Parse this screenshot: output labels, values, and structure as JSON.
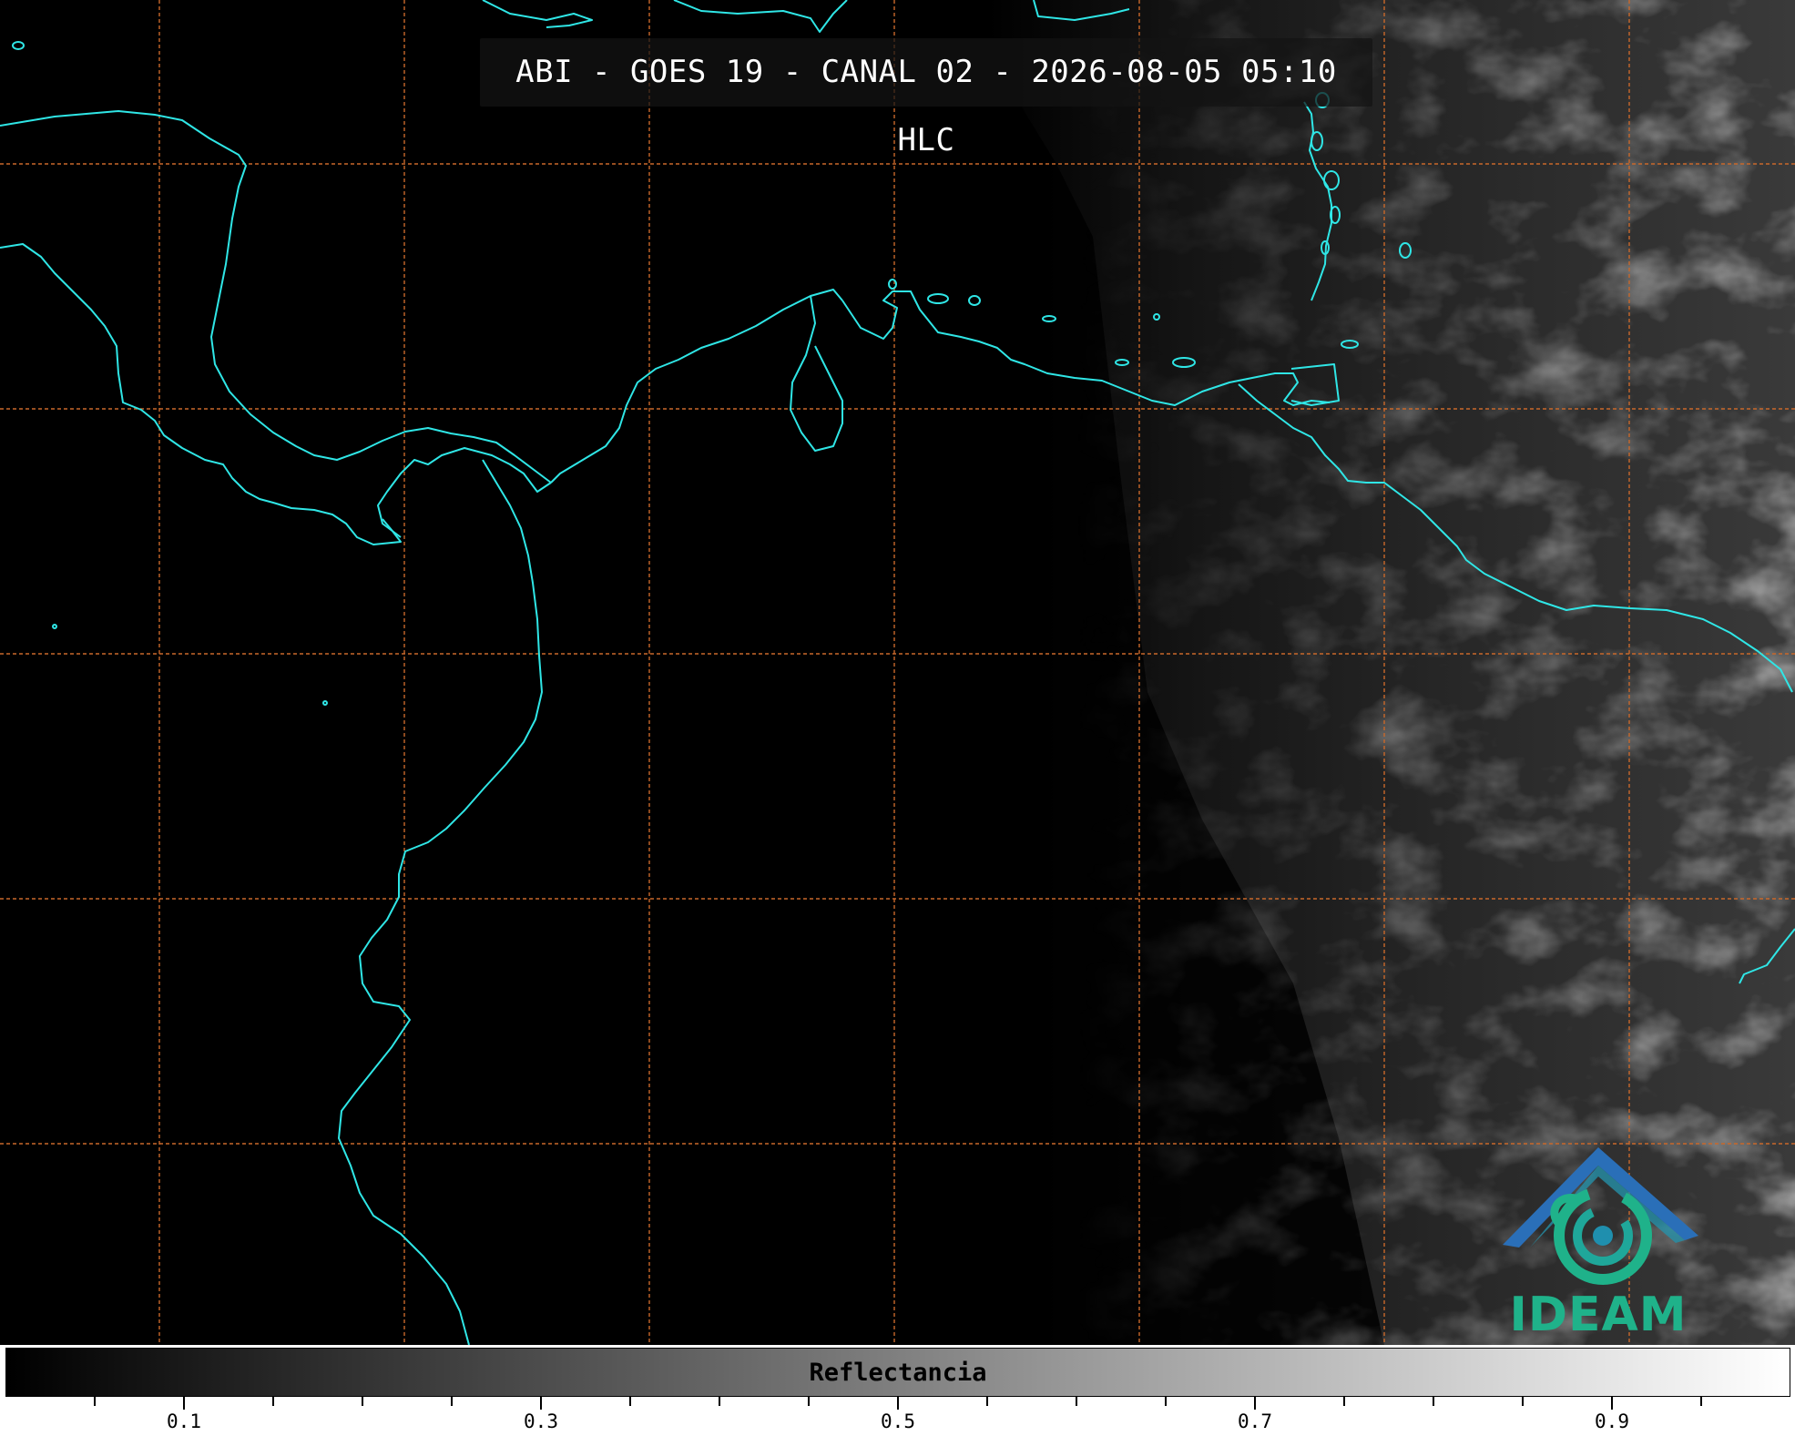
{
  "title": "ABI - GOES 19 - CANAL 02 - 2026-08-05 05:10 HLC",
  "colors": {
    "coastline": "#2fe6e6",
    "grid": "#c9682a",
    "logo_blue": "#2a6fb8",
    "logo_green": "#1fb28a"
  },
  "logo": {
    "text": "IDEAM"
  },
  "colorbar": {
    "label": "Reflectancia",
    "range": [
      0,
      1
    ],
    "major_ticks": [
      "0.1",
      "0.3",
      "0.5",
      "0.7",
      "0.9"
    ],
    "major_values": [
      0.1,
      0.3,
      0.5,
      0.7,
      0.9
    ],
    "minor_step": 0.05
  }
}
